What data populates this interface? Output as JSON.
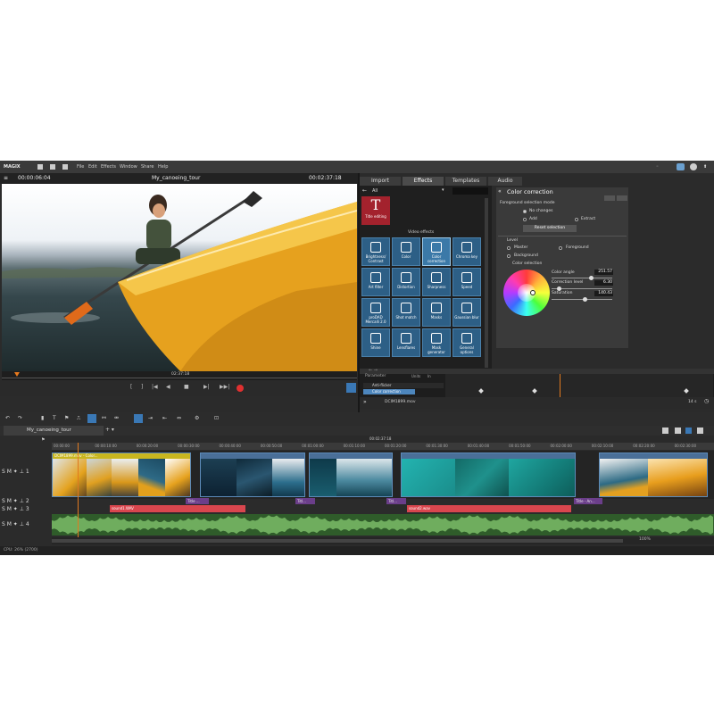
{
  "menubar": {
    "logo": "MAGIX",
    "items": [
      "File",
      "Edit",
      "Effects",
      "Window",
      "Share",
      "Help"
    ]
  },
  "player": {
    "time_current": "00:00:06:04",
    "title": "My_canoeing_tour",
    "time_total": "00:02:37:18",
    "scrub_time": "02:37:18",
    "controls": [
      "[",
      "]",
      "|◀",
      "◀",
      "■",
      "▶|",
      "▶▶|"
    ]
  },
  "media_pool": {
    "tabs": [
      {
        "label": "Import",
        "active": false
      },
      {
        "label": "Effects",
        "active": true
      },
      {
        "label": "Templates",
        "active": false
      },
      {
        "label": "Audio",
        "active": false
      }
    ],
    "filter_value": "All",
    "title_tile": {
      "glyph": "T",
      "label": "Title editing"
    },
    "section_label": "Video effects",
    "effects": [
      "Brightness/ Contrast",
      "Color",
      "Color correction",
      "Chroma key",
      "Art filter",
      "Distortion",
      "Sharpness",
      "Speed",
      "proDAD Mercalli 2.0",
      "Shot match",
      "Masks",
      "Gaussian blur",
      "Shine",
      "Lensflares",
      "Mask generator",
      "General options"
    ],
    "selected_effect": "Color correction"
  },
  "color_correction": {
    "title": "Color correction",
    "fg_mode_label": "Foreground selection mode",
    "opt_no_changes": "No changes",
    "opt_add": "Add",
    "opt_extract": "Extract",
    "reset_button": "Reset selection",
    "level_label": "Level",
    "level_master": "Master",
    "level_foreground": "Foreground",
    "level_background": "Background",
    "color_selection_label": "Color selection",
    "color_angle_label": "Color angle",
    "color_angle_value": "251.57",
    "correction_level_label": "Correction level",
    "correction_level_value": "6.30",
    "saturation_label": "Saturation",
    "saturation_value": "140.43"
  },
  "keyframe_panel": {
    "header": "Parameter",
    "col_unit": "Units",
    "col_in": "In",
    "rows": [
      "Anti-flicker",
      "Color correction"
    ],
    "file": "DCIM1899.mov",
    "speed": "14 s"
  },
  "timeline": {
    "tab": "My_canoeing_tour",
    "playhead_time": "00:02:37:18",
    "ruler_ticks": [
      "00:00:00",
      "00:00:10:00",
      "00:00:20:00",
      "00:00:30:00",
      "00:00:40:00",
      "00:00:50:00",
      "00:01:00:00",
      "00:01:10:00",
      "00:01:20:00",
      "00:01:30:00",
      "00:01:40:00",
      "00:01:50:00",
      "00:02:00:00",
      "00:02:10:00",
      "00:02:20:00",
      "00:02:30:00"
    ],
    "track_labels": [
      "S M ✦ ⊥ 1",
      "S M ✦ ⊥ 2",
      "S M ✦ ⊥ 3",
      "S M ✦ ⊥ 4"
    ],
    "clip_caption": "DCIM1899.mov - Color...",
    "title_clips": [
      "Title ...",
      "Titl...",
      "Titl...",
      "Title - An..."
    ],
    "audio_clips": [
      "sound1.WAV",
      "sound2.wav"
    ],
    "zoom": "100%"
  },
  "status": {
    "cpu": "CPU: 26% (2700)"
  },
  "colors": {
    "accent_blue": "#2d5f86",
    "title_red": "#a3222d",
    "audio_green": "#2f5c2a",
    "marker_red": "#e03030"
  }
}
